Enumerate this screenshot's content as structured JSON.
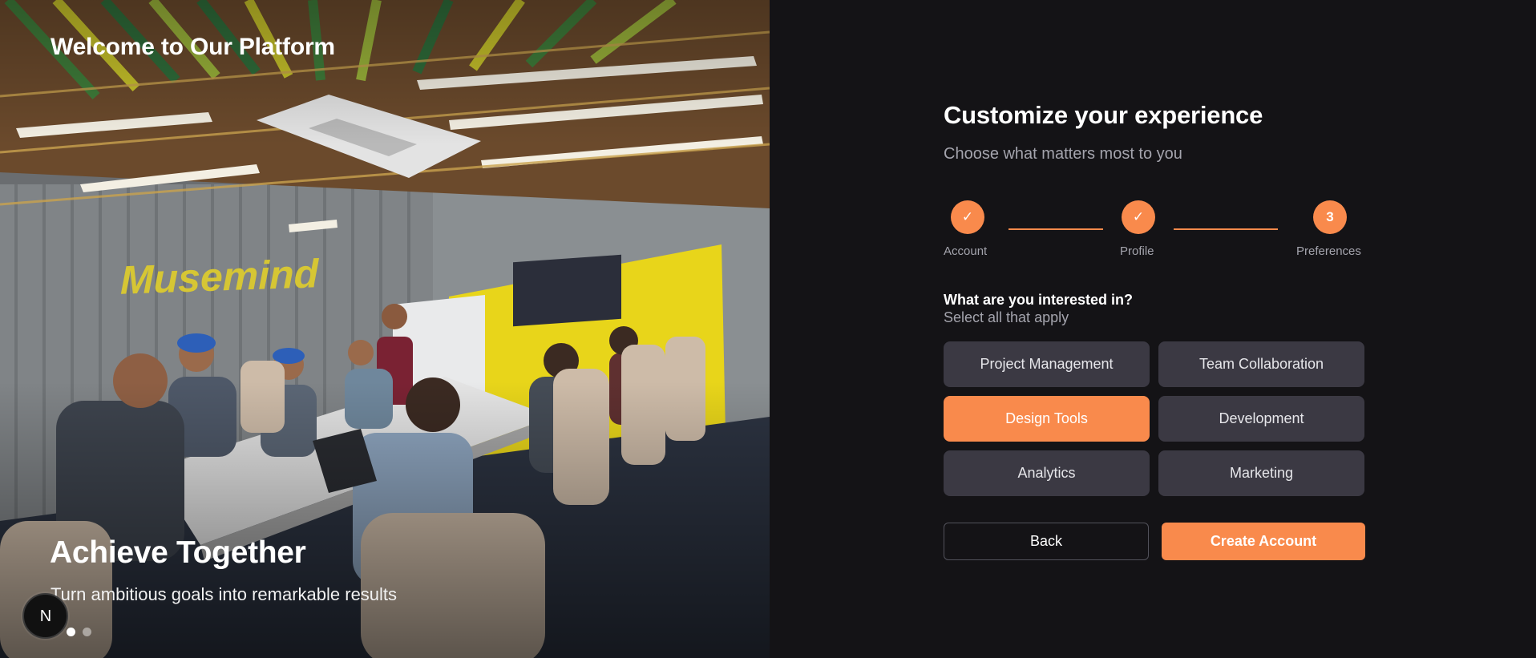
{
  "hero": {
    "brand_title": "Welcome to Our Platform",
    "slide_title": "Achieve Together",
    "slide_subtitle": "Turn ambitious goals into remarkable results",
    "wall_logo_text": "Musemind",
    "slides_total": 2,
    "active_slide": 1,
    "badge_letter": "N"
  },
  "form": {
    "title": "Customize your experience",
    "subtitle": "Choose what matters most to you",
    "steps": [
      {
        "label": "Account",
        "state": "done",
        "marker": "✓"
      },
      {
        "label": "Profile",
        "state": "done",
        "marker": "✓"
      },
      {
        "label": "Preferences",
        "state": "current",
        "marker": "3"
      }
    ],
    "question": {
      "title": "What are you interested in?",
      "subtitle": "Select all that apply"
    },
    "options": [
      {
        "label": "Project Management",
        "selected": false
      },
      {
        "label": "Team Collaboration",
        "selected": false
      },
      {
        "label": "Design Tools",
        "selected": true
      },
      {
        "label": "Development",
        "selected": false
      },
      {
        "label": "Analytics",
        "selected": false
      },
      {
        "label": "Marketing",
        "selected": false
      }
    ],
    "back_label": "Back",
    "create_label": "Create Account"
  },
  "colors": {
    "accent": "#f98a4c",
    "background": "#141316",
    "option_bg": "#3b3943",
    "muted_text": "#a4a4ad"
  }
}
